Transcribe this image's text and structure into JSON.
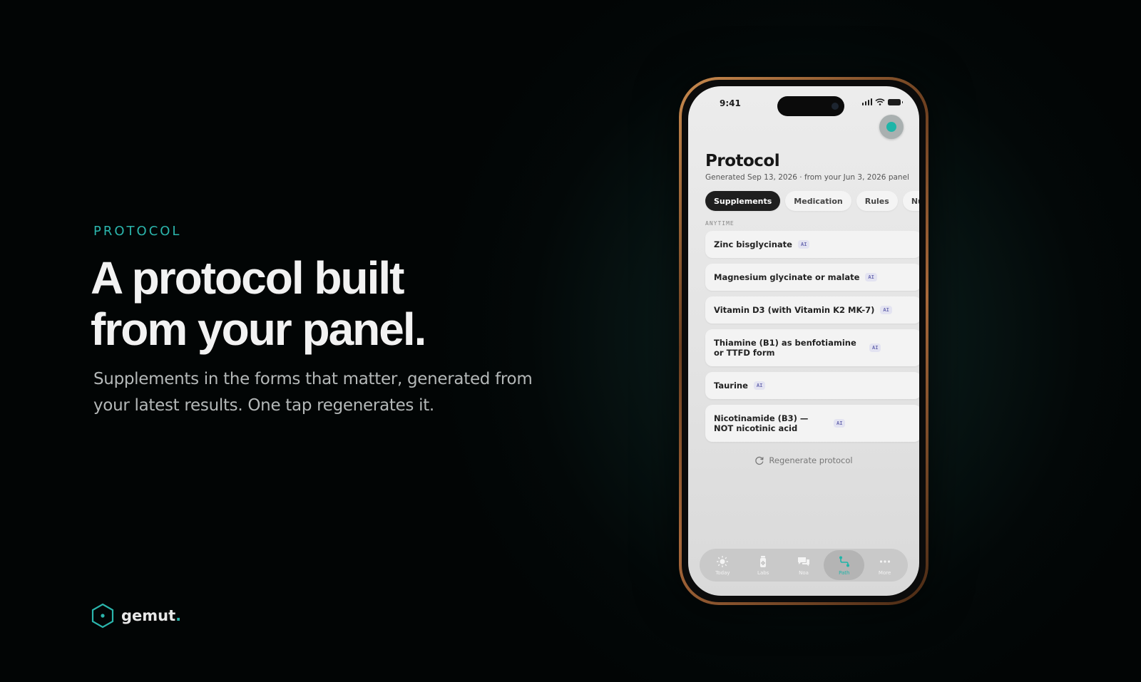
{
  "hero": {
    "eyebrow": "PROTOCOL",
    "headline_line1": "A protocol built",
    "headline_line2": "from your panel.",
    "subhead": "Supplements in the forms that matter, generated from your latest results. One tap regenerates it."
  },
  "brand": {
    "name": "gemut",
    "dot": ".",
    "accent": "#2bb5ac"
  },
  "phone": {
    "status": {
      "time": "9:41"
    },
    "title": "Protocol",
    "subtitle": "Generated Sep 13, 2026 · from your Jun 3, 2026 panel",
    "tabs": [
      {
        "label": "Supplements",
        "active": true
      },
      {
        "label": "Medication"
      },
      {
        "label": "Rules"
      },
      {
        "label": "Nutritio"
      }
    ],
    "section_label": "ANYTIME",
    "items": [
      {
        "name": "Zinc bisglycinate",
        "badge": "AI"
      },
      {
        "name": "Magnesium glycinate or malate",
        "badge": "AI"
      },
      {
        "name": "Vitamin D3 (with Vitamin K2 MK-7)",
        "badge": "AI"
      },
      {
        "name": "Thiamine (B1) as benfotiamine or TTFD form",
        "badge": "AI"
      },
      {
        "name": "Taurine",
        "badge": "AI"
      },
      {
        "name": "Nicotinamide (B3) — NOT nicotinic acid",
        "badge": "AI"
      }
    ],
    "regenerate_label": "Regenerate protocol",
    "tabbar": [
      {
        "label": "Today",
        "icon": "sun-icon"
      },
      {
        "label": "Labs",
        "icon": "vial-icon"
      },
      {
        "label": "Noa",
        "icon": "chat-icon"
      },
      {
        "label": "Path",
        "icon": "path-icon",
        "active": true
      },
      {
        "label": "More",
        "icon": "more-icon"
      }
    ],
    "accent": "#1fb5a8"
  }
}
